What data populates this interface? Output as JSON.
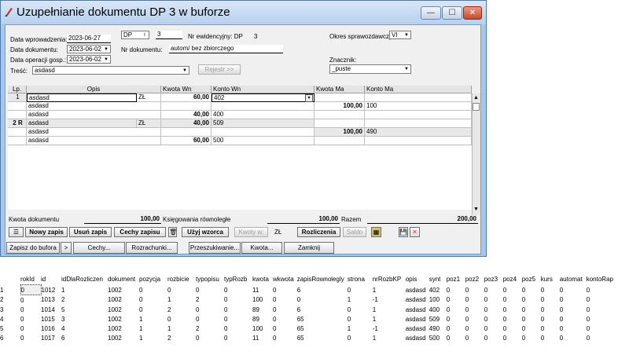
{
  "window": {
    "title": "Uzupełnianie dokumentu DP 3 w buforze",
    "min_label": "—",
    "max_label": "☐",
    "close_label": "✕"
  },
  "form": {
    "data_wprowadzenia_label": "Data wprowadzenia:",
    "data_wprowadzenia": "2023-06-27",
    "dok_typ": "DP",
    "dok_typ_arrow": "I",
    "dok_nr": "3",
    "nr_ewid_label": "Nr ewidencyjny: DP",
    "nr_ewid_value": "3",
    "okres_label": "Okres sprawozdawczy:",
    "okres_value": "VI",
    "data_dokumentu_label": "Data dokumentu:",
    "data_dokumentu": "2023-06-02",
    "nr_dokumentu_label": "Nr dokumentu:",
    "nr_dokumentu": "autom/ bez zbiorczego",
    "data_operacji_label": "Data operacji gosp.:",
    "data_operacji": "2023-06-02",
    "znacznik_label": "Znacznik:",
    "znacznik_value": "_puste",
    "tresc_label": "Treść:",
    "tresc_value": "asdasd",
    "rejestr_button": "Rejestr >>"
  },
  "grid": {
    "headers": {
      "lp": "Lp.",
      "opis": "Opis",
      "kwota_wn": "Kwota Wn",
      "konto_wn": "Konto Wn",
      "kwota_ma": "Kwota Ma",
      "konto_ma": "Konto Ma"
    },
    "rows": [
      {
        "lp": "1",
        "opis": "asdasd",
        "waluta": "ZŁ",
        "kwota_wn": "60,00",
        "konto_wn": "402",
        "kwota_ma": "",
        "konto_ma": ""
      },
      {
        "lp": "",
        "opis": "asdasd",
        "waluta": "",
        "kwota_wn": "",
        "konto_wn": "",
        "kwota_ma": "100,00",
        "konto_ma": "100"
      },
      {
        "lp": "",
        "opis": "asdasd",
        "waluta": "",
        "kwota_wn": "40,00",
        "konto_wn": "400",
        "kwota_ma": "",
        "konto_ma": ""
      },
      {
        "lp": "2",
        "flag": "R",
        "opis": "asdasd",
        "waluta": "ZŁ",
        "kwota_wn": "40,00",
        "konto_wn": "509",
        "kwota_ma": "",
        "konto_ma": ""
      },
      {
        "lp": "",
        "opis": "asdasd",
        "waluta": "",
        "kwota_wn": "",
        "konto_wn": "",
        "kwota_ma": "100,00",
        "konto_ma": "490"
      },
      {
        "lp": "",
        "opis": "asdasd",
        "waluta": "",
        "kwota_wn": "60,00",
        "konto_wn": "500",
        "kwota_ma": "",
        "konto_ma": ""
      }
    ]
  },
  "totals": {
    "kwota_dok_label": "Kwota dokumentu",
    "kwota_dok": "100,00",
    "ksieg_label": "Księgowania równoległe",
    "ksieg_value": "100,00",
    "razem_label": "Razem",
    "razem_value": "200,00"
  },
  "toolbar1": {
    "nowy": "Nowy zapis",
    "usun": "Usuń zapis",
    "cechy_zapisu": "Cechy zapisu",
    "uzyj_wzorca": "Użyj wzorca",
    "kwoty_w": "Kwoty w:",
    "waluta": "ZŁ",
    "rozliczenia": "Rozliczenia",
    "saldo": "Saldo"
  },
  "toolbar2": {
    "zapisz": "Zapisz do bufora",
    "arrow": ">",
    "cechy": "Cechy...",
    "rozrachunki": "Rozrachunki...",
    "przeszukiwanie": "Przeszukiwanie...",
    "kwota": "Kwota...",
    "zamknij": "Zamknij"
  },
  "results": {
    "columns": [
      "",
      "rokId",
      "id",
      "idDlaRozliczen",
      "dokument",
      "pozycja",
      "rozbicie",
      "typopisu",
      "typRozb",
      "kwota",
      "wkwota",
      "zapisRownolegly",
      "strona",
      "nrRozbKP",
      "opis",
      "synt",
      "poz1",
      "poz2",
      "poz3",
      "poz4",
      "poz5",
      "kurs",
      "automat",
      "kontoRap"
    ],
    "rows": [
      [
        "1",
        "0",
        "1012",
        "1",
        "1002",
        "0",
        "0",
        "0",
        "0",
        "11",
        "0",
        "6",
        "0",
        "1",
        "asdasd",
        "402",
        "0",
        "0",
        "0",
        "0",
        "0",
        "0",
        "0",
        "0"
      ],
      [
        "2",
        "0",
        "1013",
        "2",
        "1002",
        "0",
        "1",
        "2",
        "0",
        "100",
        "0",
        "0",
        "1",
        "-1",
        "asdasd",
        "100",
        "0",
        "0",
        "0",
        "0",
        "0",
        "0",
        "0",
        "0"
      ],
      [
        "3",
        "0",
        "1014",
        "5",
        "1002",
        "0",
        "2",
        "0",
        "0",
        "89",
        "0",
        "6",
        "0",
        "1",
        "asdasd",
        "400",
        "0",
        "0",
        "0",
        "0",
        "0",
        "0",
        "0",
        "0"
      ],
      [
        "4",
        "0",
        "1015",
        "3",
        "1002",
        "1",
        "0",
        "0",
        "0",
        "89",
        "0",
        "65",
        "0",
        "1",
        "asdasd",
        "509",
        "0",
        "0",
        "0",
        "0",
        "0",
        "0",
        "0",
        "0"
      ],
      [
        "5",
        "0",
        "1016",
        "4",
        "1002",
        "1",
        "1",
        "2",
        "0",
        "100",
        "0",
        "65",
        "1",
        "-1",
        "asdasd",
        "490",
        "0",
        "0",
        "0",
        "0",
        "0",
        "0",
        "0",
        "0"
      ],
      [
        "6",
        "0",
        "1017",
        "6",
        "1002",
        "1",
        "2",
        "0",
        "0",
        "11",
        "0",
        "65",
        "0",
        "1",
        "asdasd",
        "500",
        "0",
        "0",
        "0",
        "0",
        "0",
        "0",
        "0",
        "0"
      ]
    ]
  }
}
